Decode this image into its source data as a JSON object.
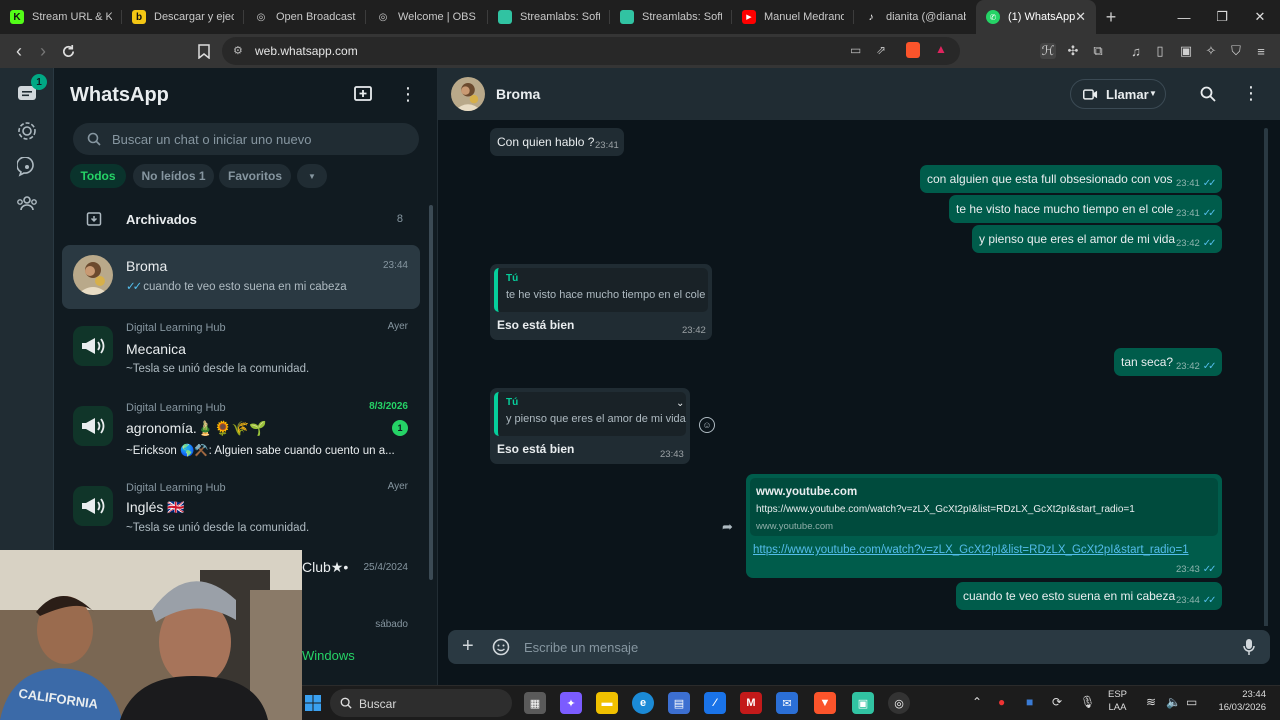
{
  "browser": {
    "tabs": [
      {
        "label": "Stream URL & Key",
        "icon_color": "#53fc18",
        "icon_letter": "K"
      },
      {
        "label": "Descargar y ejecut",
        "icon_color": "#f3c614",
        "icon_letter": "b"
      },
      {
        "label": "Open Broadcaster",
        "icon_color": "#777777",
        "icon_letter": "◎"
      },
      {
        "label": "Welcome | OBS",
        "icon_color": "#777777",
        "icon_letter": "◎"
      },
      {
        "label": "Streamlabs: Softw",
        "icon_color": "#31c3a2",
        "icon_letter": "▣"
      },
      {
        "label": "Streamlabs: Softw",
        "icon_color": "#31c3a2",
        "icon_letter": "▣"
      },
      {
        "label": "Manuel Medrano",
        "icon_color": "#ff0000",
        "icon_letter": "▶"
      },
      {
        "label": "dianita (@dianabe",
        "icon_color": "#111111",
        "icon_letter": "♪"
      }
    ],
    "active_tab": {
      "label": "(1) WhatsApp",
      "close": "✕"
    },
    "new_tab": "+",
    "url": "web.whatsapp.com"
  },
  "rail": {
    "chats_badge": "1"
  },
  "sidebar": {
    "title": "WhatsApp",
    "search_placeholder": "Buscar un chat o iniciar uno nuevo",
    "filters": {
      "all": "Todos",
      "unread": "No leídos 1",
      "favorites": "Favoritos"
    },
    "archived": {
      "label": "Archivados",
      "count": "8"
    },
    "chats": [
      {
        "name": "Broma",
        "time": "23:44",
        "preview": "cuando te veo esto suena en mi cabeza",
        "ticks": "✓✓"
      },
      {
        "hub": "Digital Learning Hub",
        "name": "Mecanica",
        "time": "Ayer",
        "preview": "~Tesla se unió desde la comunidad."
      },
      {
        "hub": "Digital Learning Hub",
        "name": "agronomía.🎍🌻🌾🌱",
        "time": "8/3/2026",
        "preview": "~Erickson 🌎⚒️: Alguien sabe cuando cuento un a...",
        "unread": "1"
      },
      {
        "hub": "Digital Learning Hub",
        "name": "Inglés 🇬🇧",
        "time": "Ayer",
        "preview": "~Tesla se unió desde la comunidad."
      },
      {
        "name": "Club★•",
        "time": "25/4/2024"
      },
      {
        "time": "sábado"
      }
    ],
    "windows_text": "Windows"
  },
  "conversation": {
    "contact": "Broma",
    "call_label": "Llamar",
    "messages": [
      {
        "dir": "in",
        "text": "Con quien hablo ?",
        "time": "23:41"
      },
      {
        "dir": "out",
        "text": "con alguien que esta full obsesionado con vos",
        "time": "23:41"
      },
      {
        "dir": "out",
        "text": "te he visto hace mucho tiempo en el cole",
        "time": "23:41"
      },
      {
        "dir": "out",
        "text": "y pienso que eres el amor de mi vida",
        "time": "23:42"
      },
      {
        "dir": "in",
        "quote_author": "Tú",
        "quote": "te he visto hace mucho tiempo en el cole",
        "text": "Eso está bien",
        "time": "23:42"
      },
      {
        "dir": "out",
        "text": "tan seca?",
        "time": "23:42"
      },
      {
        "dir": "in",
        "quote_author": "Tú",
        "quote": "y pienso que eres el amor de mi vida",
        "text": "Eso está bien",
        "time": "23:43"
      },
      {
        "dir": "out",
        "link_title": "www.youtube.com",
        "link_url": "https://www.youtube.com/watch?v=zLX_GcXt2pI&list=RDzLX_GcXt2pI&start_radio=1",
        "link_domain": "www.youtube.com",
        "text": "https://www.youtube.com/watch?v=zLX_GcXt2pI&list=RDzLX_GcXt2pI&start_radio=1",
        "time": "23:43"
      },
      {
        "dir": "out",
        "text": "cuando te veo esto suena en mi cabeza",
        "time": "23:44"
      }
    ],
    "composer_placeholder": "Escribe un mensaje"
  },
  "taskbar": {
    "search": "Buscar",
    "lang": "ESP",
    "lang2": "LAA",
    "time": "23:44",
    "date": "16/03/2026"
  },
  "colors": {
    "accent": "#00a884",
    "outgoing_bubble": "#005c4b",
    "incoming_bubble": "#202c33",
    "read_ticks": "#53bdeb"
  }
}
